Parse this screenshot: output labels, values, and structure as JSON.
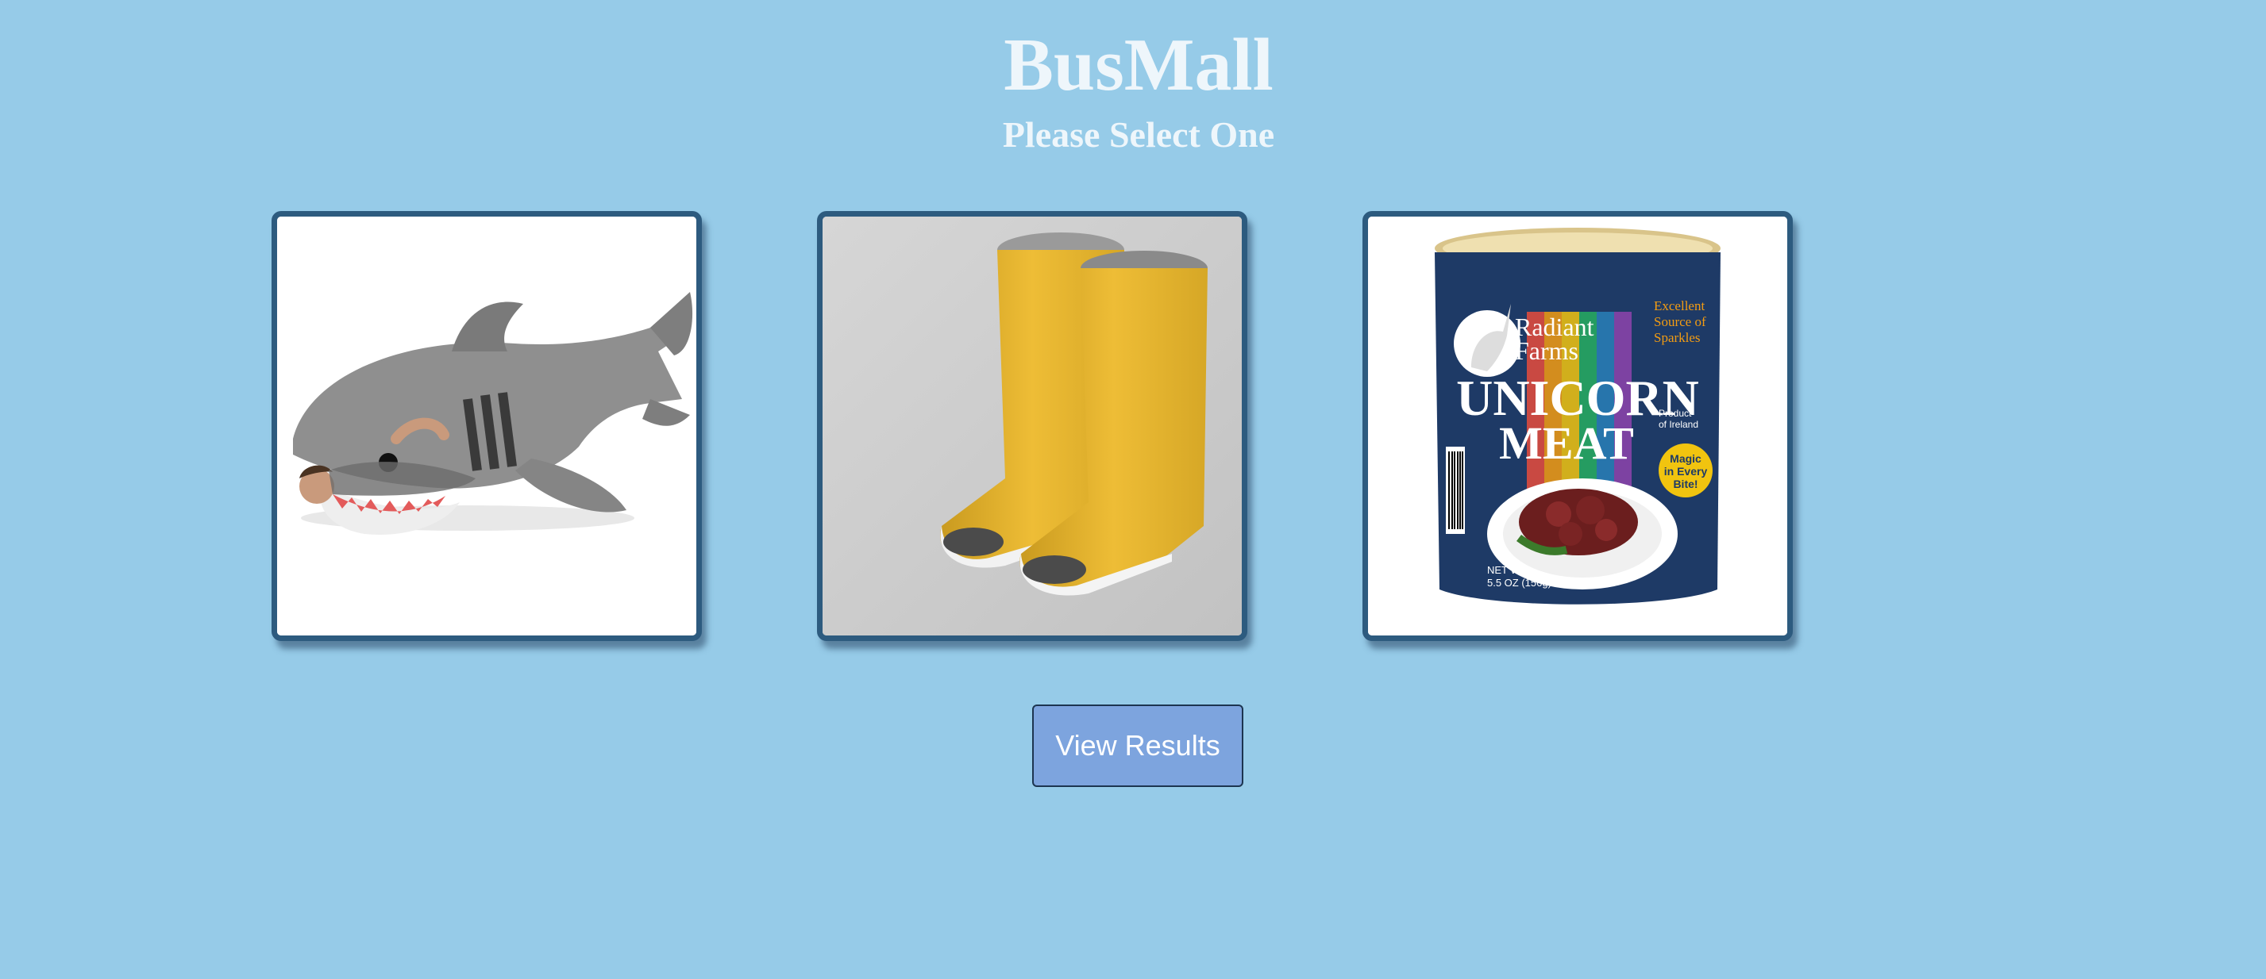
{
  "header": {
    "title": "BusMall",
    "subtitle": "Please Select One"
  },
  "products": [
    {
      "name": "shark-sleeping-bag",
      "icon": "shark-sleeping-bag-image"
    },
    {
      "name": "open-toe-rain-boots",
      "icon": "rain-boots-image"
    },
    {
      "name": "unicorn-meat-can",
      "icon": "unicorn-meat-can-image",
      "label_brand_line1": "Radiant",
      "label_brand_line2": "Farms",
      "label_main_line1": "UNICORN",
      "label_main_line2": "MEAT",
      "label_side_line1": "Excellent",
      "label_side_line2": "Source of",
      "label_side_line3": "Sparkles",
      "label_origin_line1": "Product",
      "label_origin_line2": "of Ireland",
      "label_badge_line1": "Magic",
      "label_badge_line2": "in Every",
      "label_badge_line3": "Bite!",
      "label_weight_line1": "NET WT",
      "label_weight_line2": "5.5 OZ (156g)"
    }
  ],
  "actions": {
    "view_results_label": "View Results"
  },
  "colors": {
    "background": "#96cbe8",
    "title_text": "#eef6fb",
    "card_border": "#2d5b7f",
    "button_fill": "#7da4de"
  }
}
